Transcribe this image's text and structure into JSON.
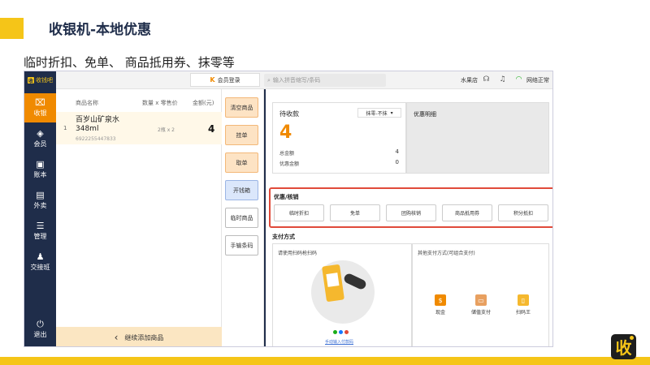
{
  "slide": {
    "title": "收银机-本地优惠",
    "subtitle": "临时折扣、免单、 商品抵用券、抹零等",
    "corner_logo_char": "收"
  },
  "colors": {
    "accent": "#f5c518",
    "navy": "#1f2d4a",
    "orange": "#f08a00",
    "highlight": "#e04a3a"
  },
  "app": {
    "brand": "收钱吧",
    "brand_icon_char": "收",
    "member_login": "会员登录",
    "member_login_icon": "K",
    "search_placeholder": "输入拼音缩写/条码",
    "store": "水果店",
    "network_status": "网络正常",
    "icons": {
      "headset": "headset-icon",
      "bell": "bell-icon",
      "wifi": "wifi-icon",
      "search": "search-icon"
    }
  },
  "sidebar": {
    "items": [
      {
        "label": "收银",
        "icon": "cashier-icon",
        "glyph": "⌧"
      },
      {
        "label": "会员",
        "icon": "member-icon",
        "glyph": "◈"
      },
      {
        "label": "账本",
        "icon": "ledger-icon",
        "glyph": "▣"
      },
      {
        "label": "外卖",
        "icon": "takeout-icon",
        "glyph": "▤"
      },
      {
        "label": "管理",
        "icon": "manage-icon",
        "glyph": "☰"
      },
      {
        "label": "交接班",
        "icon": "handover-icon",
        "glyph": "♟"
      },
      {
        "label": "退出",
        "icon": "logout-icon",
        "glyph": "⏻"
      }
    ]
  },
  "cart": {
    "headers": {
      "name": "商品名称",
      "qty_price": "数量 x 零售价",
      "amount": "金额(元)"
    },
    "rows": [
      {
        "index": "1",
        "name": "百岁山矿泉水",
        "spec": "348ml",
        "code": "6922255447833",
        "qty_price": "2瓶 x 2",
        "amount": "4"
      }
    ],
    "add_more": "继续添加商品"
  },
  "actions": {
    "items": [
      "清空商品",
      "挂单",
      "取单",
      "开钱箱",
      "临时商品",
      "手输条码"
    ]
  },
  "payment": {
    "pending_title": "待收款",
    "erase_option": "抹零-不抹",
    "pending_amount": "4",
    "total_label": "总金额",
    "total_value": "4",
    "discount_label": "优惠金额",
    "discount_value": "0",
    "discount_detail_title": "优惠明细"
  },
  "coupons": {
    "title": "优惠/核销",
    "buttons": [
      "临时折扣",
      "免单",
      "团购核销",
      "商品抵用券",
      "积分抵扣"
    ]
  },
  "pay_methods": {
    "title": "支付方式",
    "scan_hint": "请使用扫码枪扫码",
    "manual_link": "手动输入付款码",
    "other_title": "其他支付方式(可组合支付)",
    "methods": [
      {
        "label": "现金",
        "icon": "cash-icon",
        "color": "#f08a00",
        "glyph": "$"
      },
      {
        "label": "储值支付",
        "icon": "stored-value-icon",
        "color": "#e8a060",
        "glyph": "▭"
      },
      {
        "label": "扫码王",
        "icon": "scanner-king-icon",
        "color": "#f5b82e",
        "glyph": "▯"
      }
    ],
    "brand_dot_colors": [
      "#1aad19",
      "#1677ff",
      "#e04a3a"
    ]
  }
}
